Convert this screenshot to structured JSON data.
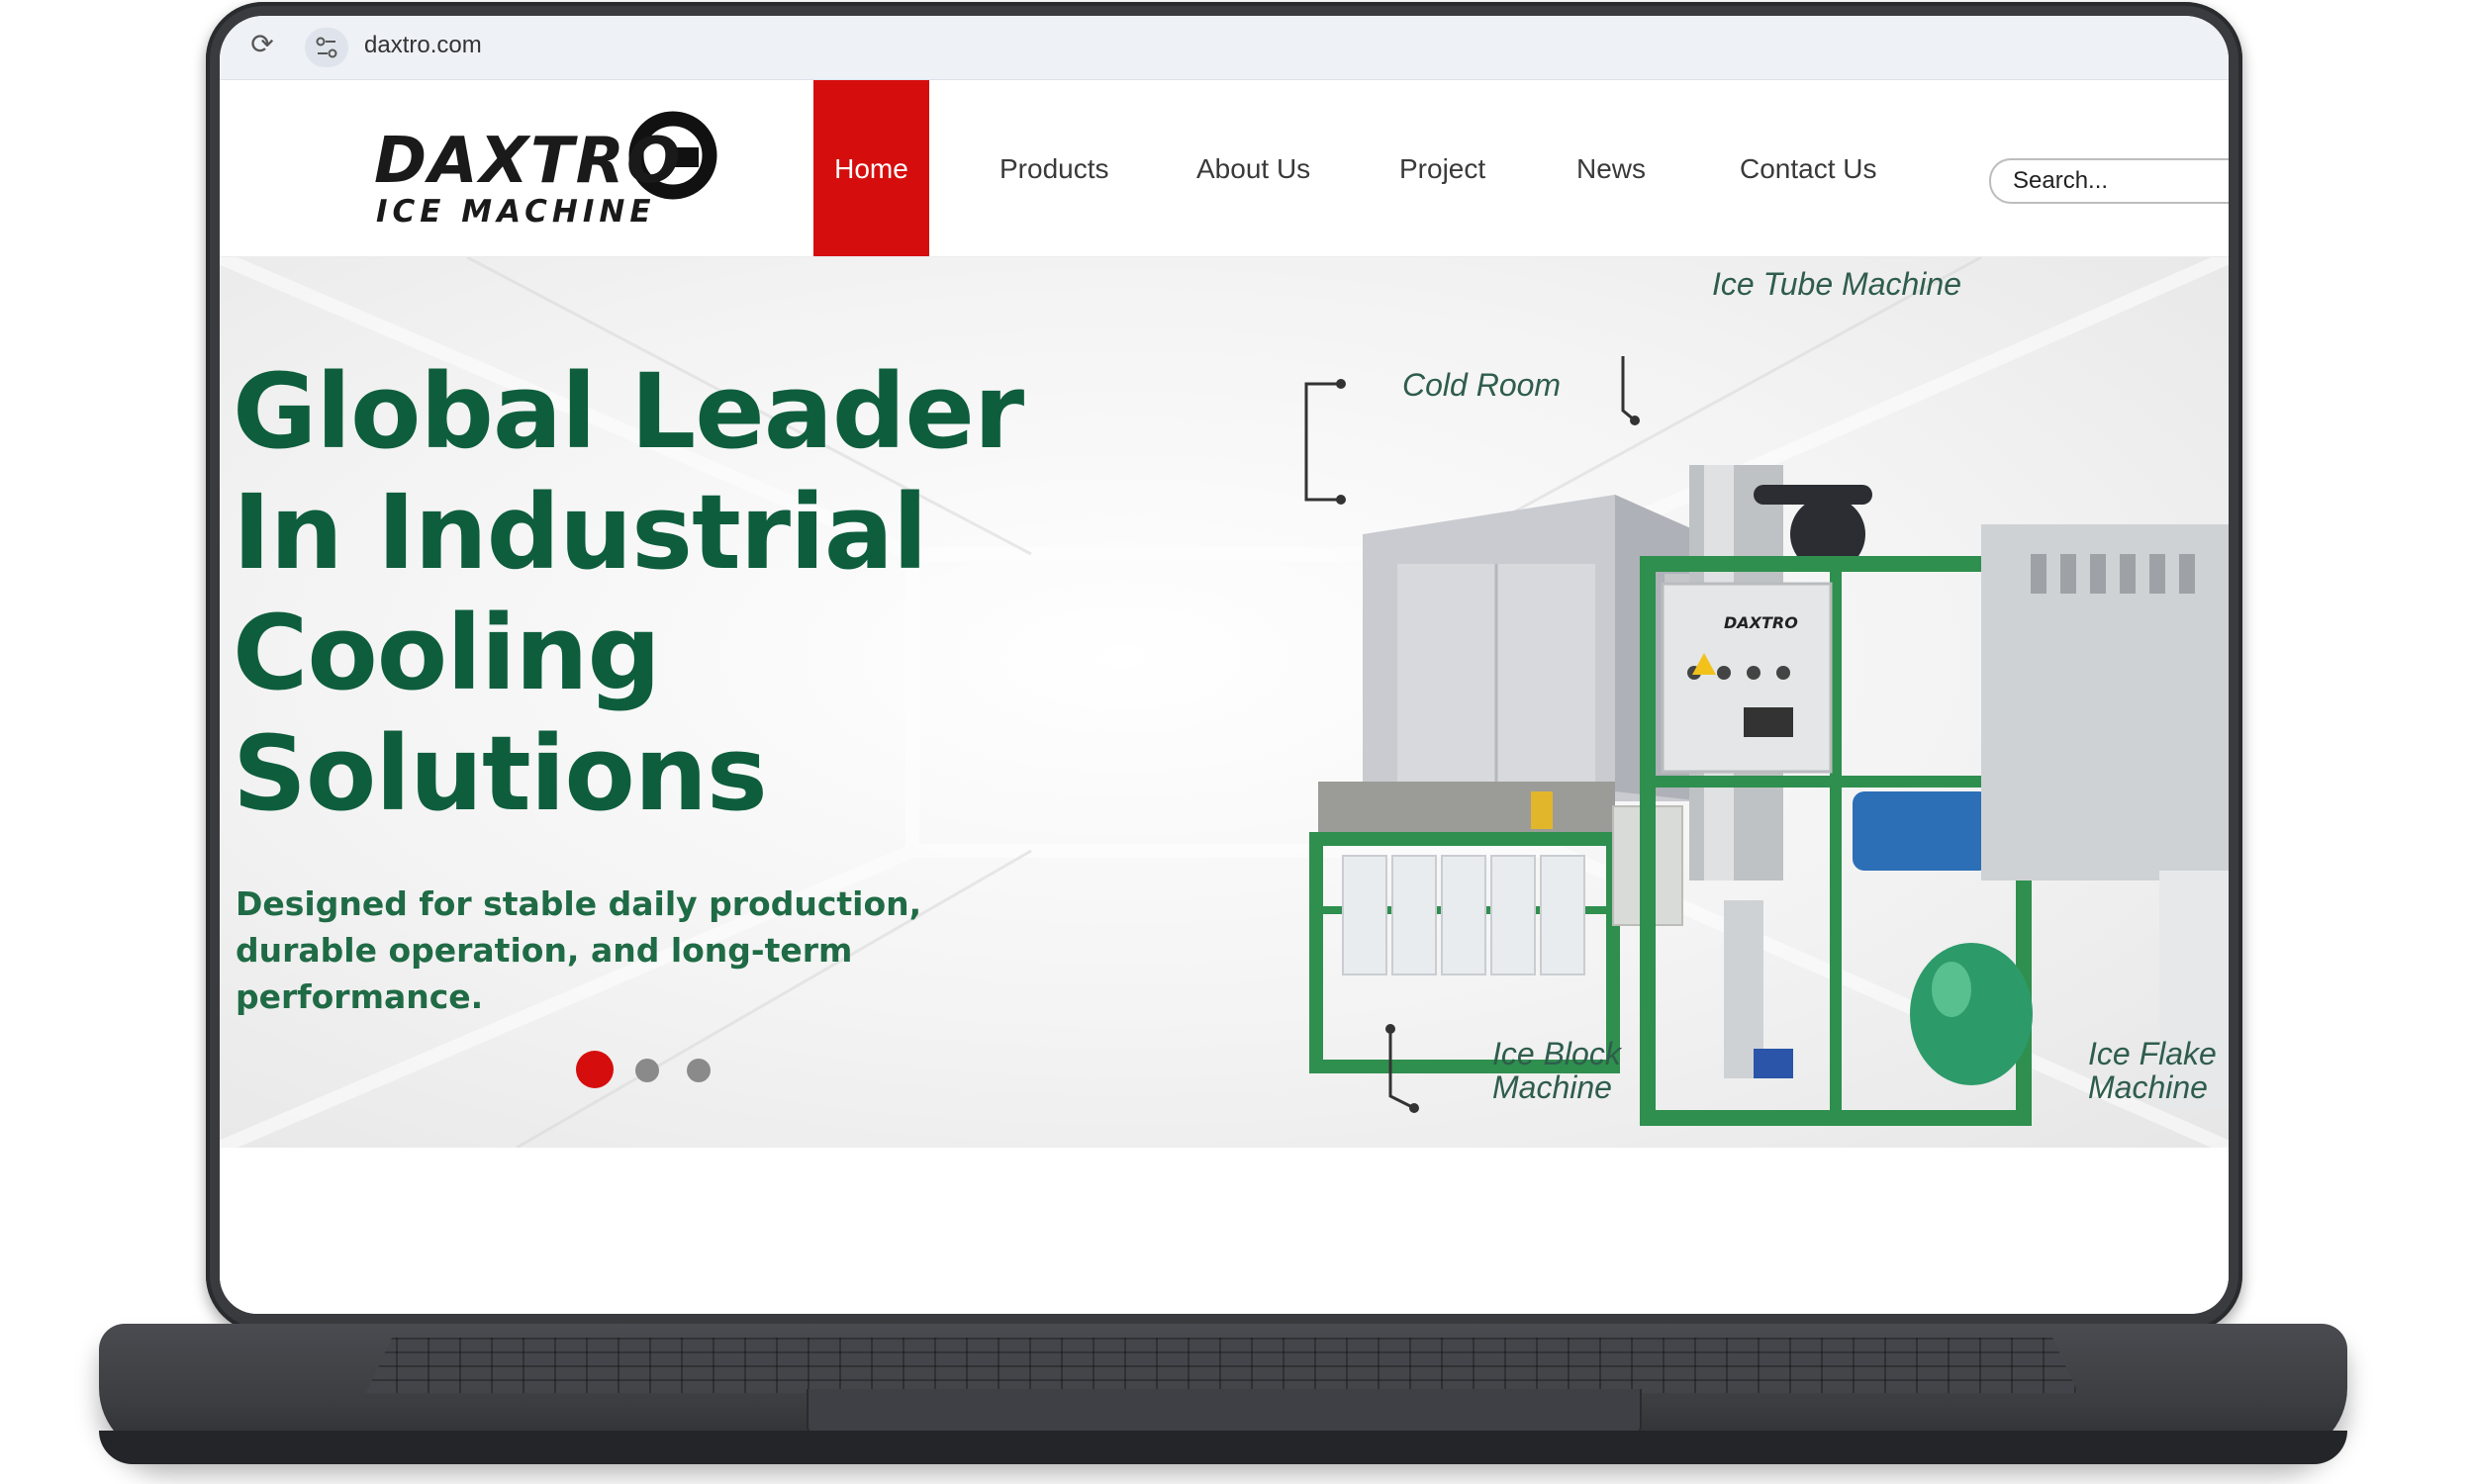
{
  "browser": {
    "url": "daxtro.com",
    "reload_icon": "reload-icon",
    "site_info_icon": "tune-icon"
  },
  "logo": {
    "wordmark": "DAXTRO",
    "tagline": "ICE MACHINE"
  },
  "nav": {
    "items": [
      {
        "label": "Home",
        "active": true
      },
      {
        "label": "Products",
        "active": false
      },
      {
        "label": "About Us",
        "active": false
      },
      {
        "label": "Project",
        "active": false
      },
      {
        "label": "News",
        "active": false
      },
      {
        "label": "Contact Us",
        "active": false
      }
    ]
  },
  "search": {
    "placeholder": "Search..."
  },
  "hero": {
    "title_lines": [
      "Global Leader",
      "In Industrial",
      "Cooling",
      "Solutions"
    ],
    "subtitle": "Designed for stable daily production, durable operation, and long-term performance.",
    "slides": {
      "total": 3,
      "active": 1
    },
    "callouts": {
      "cold_room": "Cold Room",
      "ice_tube": "Ice Tube Machine",
      "ice_block": [
        "Ice Block",
        "Machine"
      ],
      "ice_flake": [
        "Ice Flake",
        "Machine"
      ]
    },
    "machine_brand": "DAXTRO"
  },
  "colors": {
    "accent_red": "#d60d0d",
    "brand_green": "#0e5e3d",
    "frame_green": "#2f8f4e"
  }
}
